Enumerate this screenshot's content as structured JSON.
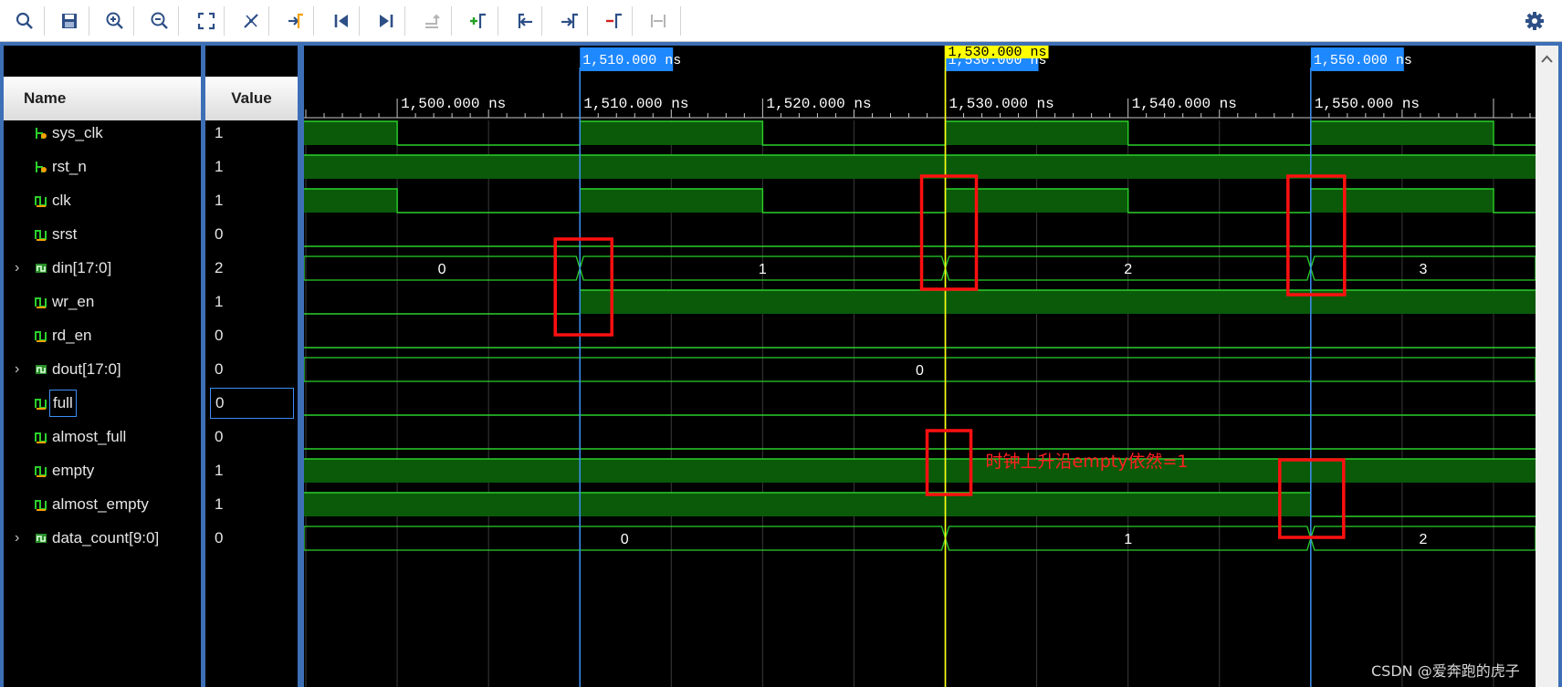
{
  "toolbar": {
    "buttons": [
      {
        "name": "search-icon"
      },
      {
        "name": "save-icon"
      },
      {
        "name": "zoom-in-icon"
      },
      {
        "name": "zoom-out-icon"
      },
      {
        "name": "zoom-fit-icon"
      },
      {
        "name": "go-to-cursor-icon"
      },
      {
        "name": "go-to-time-zero-icon"
      },
      {
        "name": "go-to-first-icon"
      },
      {
        "name": "go-to-last-icon"
      },
      {
        "name": "swap-cursors-icon"
      },
      {
        "name": "add-marker-icon"
      },
      {
        "name": "previous-marker-icon"
      },
      {
        "name": "next-marker-icon"
      },
      {
        "name": "delete-marker-icon"
      },
      {
        "name": "snap-icon"
      }
    ],
    "settings_icon": "gear-icon"
  },
  "headers": {
    "name": "Name",
    "value": "Value"
  },
  "signals": [
    {
      "name": "sys_clk",
      "value": "1",
      "bus": false,
      "type": "clock",
      "icon": "input-port-icon"
    },
    {
      "name": "rst_n",
      "value": "1",
      "bus": false,
      "type": "high",
      "icon": "input-port-icon"
    },
    {
      "name": "clk",
      "value": "1",
      "bus": false,
      "type": "clock",
      "icon": "signal-icon"
    },
    {
      "name": "srst",
      "value": "0",
      "bus": false,
      "type": "low",
      "icon": "signal-icon"
    },
    {
      "name": "din[17:0]",
      "value": "2",
      "bus": true,
      "type": "bus",
      "icon": "bus-icon",
      "segments": [
        {
          "start": 1494.9,
          "value": "0"
        },
        {
          "start": 1510,
          "value": "1"
        },
        {
          "start": 1530,
          "value": "2"
        },
        {
          "start": 1550,
          "value": "3"
        }
      ]
    },
    {
      "name": "wr_en",
      "value": "1",
      "bus": false,
      "type": "step",
      "icon": "signal-icon",
      "transitions": [
        {
          "t": 1494.9,
          "level": 0
        },
        {
          "t": 1510,
          "level": 1
        }
      ]
    },
    {
      "name": "rd_en",
      "value": "0",
      "bus": false,
      "type": "low",
      "icon": "signal-icon"
    },
    {
      "name": "dout[17:0]",
      "value": "0",
      "bus": true,
      "type": "bus",
      "icon": "bus-icon",
      "segments": [
        {
          "start": 1494.9,
          "value": "0"
        }
      ]
    },
    {
      "name": "full",
      "value": "0",
      "bus": false,
      "type": "low",
      "icon": "signal-icon",
      "selected": true
    },
    {
      "name": "almost_full",
      "value": "0",
      "bus": false,
      "type": "low",
      "icon": "signal-icon"
    },
    {
      "name": "empty",
      "value": "1",
      "bus": false,
      "type": "high",
      "icon": "signal-icon"
    },
    {
      "name": "almost_empty",
      "value": "1",
      "bus": false,
      "type": "step",
      "icon": "signal-icon",
      "transitions": [
        {
          "t": 1494.9,
          "level": 1
        },
        {
          "t": 1550,
          "level": 0
        }
      ]
    },
    {
      "name": "data_count[9:0]",
      "value": "0",
      "bus": true,
      "type": "bus",
      "icon": "bus-icon",
      "segments": [
        {
          "start": 1494.9,
          "value": "0"
        },
        {
          "start": 1530,
          "value": "1"
        },
        {
          "start": 1550,
          "value": "2"
        }
      ]
    }
  ],
  "timeline": {
    "start_ns": 1494.9,
    "end_ns": 1562.3,
    "clock_period_ns": 20,
    "clock_first_rise_ns": 1490,
    "ticks": [
      {
        "t": 1500,
        "label": "1,500.000 ns"
      },
      {
        "t": 1510,
        "label": "1,510.000 ns"
      },
      {
        "t": 1520,
        "label": "1,520.000 ns"
      },
      {
        "t": 1530,
        "label": "1,530.000 ns"
      },
      {
        "t": 1540,
        "label": "1,540.000 ns"
      },
      {
        "t": 1550,
        "label": "1,550.000 ns"
      }
    ]
  },
  "markers": [
    {
      "t": 1510,
      "label": "1,510.000 ns",
      "color": "#3d8ff5",
      "kind": "marker"
    },
    {
      "t": 1530,
      "label": "1,530.000 ns",
      "color": "#3d8ff5",
      "kind": "marker"
    },
    {
      "t": 1550,
      "label": "1,550.000 ns",
      "color": "#3d8ff5",
      "kind": "marker"
    }
  ],
  "cursor": {
    "t": 1530,
    "label": "1,530.000 ns",
    "color": "#ffff00"
  },
  "annotation": {
    "text": "时钟上升沿empty依然=1",
    "color": "#ff2020"
  },
  "colors": {
    "wave": "#2ad02a",
    "wave_fill": "#0a5a0a",
    "grid": "#3a3a3a",
    "highlight": "#ff1010"
  },
  "watermark": "CSDN @爱奔跑的虎子"
}
